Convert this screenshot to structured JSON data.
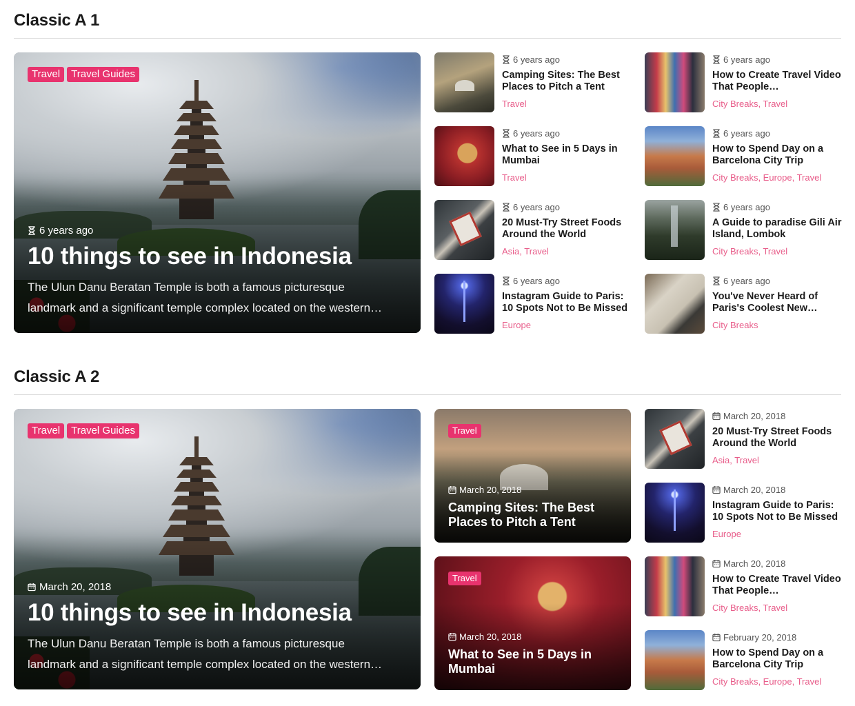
{
  "sections": [
    {
      "title": "Classic A 1",
      "feature": {
        "tags": [
          "Travel",
          "Travel Guides"
        ],
        "meta": "6 years ago",
        "title": "10 things to see in Indonesia",
        "excerpt_line1": "The Ulun Danu Beratan Temple is both a famous picturesque",
        "excerpt_line2": "landmark and a significant temple complex located on the western…"
      },
      "col1": [
        {
          "meta": "6 years ago",
          "title": "Camping Sites: The Best Places to Pitch a Tent",
          "cats": "Travel"
        },
        {
          "meta": "6 years ago",
          "title": "What to See in 5 Days in Mumbai",
          "cats": "Travel"
        },
        {
          "meta": "6 years ago",
          "title": "20 Must-Try Street Foods Around the World",
          "cats": "Asia, Travel"
        },
        {
          "meta": "6 years ago",
          "title": "Instagram Guide to Paris: 10 Spots Not to Be Missed",
          "cats": "Europe"
        }
      ],
      "col2": [
        {
          "meta": "6 years ago",
          "title": "How to Create Travel Video That People…",
          "cats": "City Breaks, Travel"
        },
        {
          "meta": "6 years ago",
          "title": "How to Spend Day on a Barcelona City Trip",
          "cats": "City Breaks, Europe, Travel"
        },
        {
          "meta": "6 years ago",
          "title": "A Guide to paradise Gili Air Island, Lombok",
          "cats": "City Breaks, Travel"
        },
        {
          "meta": "6 years ago",
          "title": "You've Never Heard of Paris's Coolest New…",
          "cats": "City Breaks"
        }
      ]
    },
    {
      "title": "Classic A 2",
      "feature": {
        "tags": [
          "Travel",
          "Travel Guides"
        ],
        "meta": "March 20, 2018",
        "title": "10 things to see in Indonesia",
        "excerpt_line1": "The Ulun Danu Beratan Temple is both a famous picturesque",
        "excerpt_line2": "landmark and a significant temple complex located on the western…"
      },
      "cards": [
        {
          "tag": "Travel",
          "meta": "March 20, 2018",
          "title": "Camping Sites: The Best Places to Pitch a Tent"
        },
        {
          "tag": "Travel",
          "meta": "March 20, 2018",
          "title": "What to See in 5 Days in Mumbai"
        }
      ],
      "col2": [
        {
          "meta": "March 20, 2018",
          "title": "20 Must-Try Street Foods Around the World",
          "cats": "Asia, Travel"
        },
        {
          "meta": "March 20, 2018",
          "title": "Instagram Guide to Paris: 10 Spots Not to Be Missed",
          "cats": "Europe"
        },
        {
          "meta": "March 20, 2018",
          "title": "How to Create Travel Video That People…",
          "cats": "City Breaks, Travel"
        },
        {
          "meta": "February 20, 2018",
          "title": "How to Spend Day on a Barcelona City Trip",
          "cats": "City Breaks, Europe, Travel"
        }
      ]
    }
  ],
  "colors": {
    "accent": "#e8336e",
    "category_text": "#e85d8a"
  },
  "icons": {
    "time": "hourglass-icon",
    "date": "calendar-icon"
  }
}
